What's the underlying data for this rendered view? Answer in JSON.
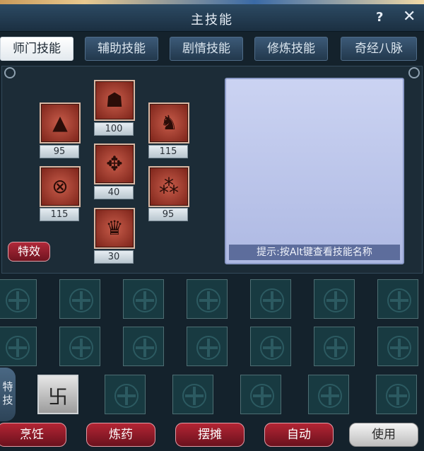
{
  "window": {
    "title": "主技能",
    "help_label": "?",
    "close_label": "✕"
  },
  "tabs": [
    {
      "label": "师门技能",
      "active": true
    },
    {
      "label": "辅助技能",
      "active": false
    },
    {
      "label": "剧情技能",
      "active": false
    },
    {
      "label": "修炼技能",
      "active": false
    },
    {
      "label": "奇经八脉",
      "active": false
    }
  ],
  "skills": [
    {
      "icon": "pagoda-icon",
      "glyph": "▲",
      "level": "95"
    },
    {
      "icon": "demon-mask-icon",
      "glyph": "☗",
      "level": "100"
    },
    {
      "icon": "dragon-head-icon",
      "glyph": "♞",
      "level": "115"
    },
    {
      "icon": "talisman-icon",
      "glyph": "✥",
      "level": "40"
    },
    {
      "icon": "round-seal-icon",
      "glyph": "⊗",
      "level": "115"
    },
    {
      "icon": "grid-seal-icon",
      "glyph": "⁂",
      "level": "95"
    },
    {
      "icon": "flame-crown-icon",
      "glyph": "♛",
      "level": "30"
    }
  ],
  "effect_button": "特效",
  "preview": {
    "hint": "提示:按Alt键查看技能名称"
  },
  "special": {
    "label": "特技",
    "icon": "special-glyph-icon",
    "glyph": "卐"
  },
  "buttons": [
    {
      "label": "烹饪",
      "style": "red"
    },
    {
      "label": "炼药",
      "style": "red"
    },
    {
      "label": "摆摊",
      "style": "red"
    },
    {
      "label": "自动",
      "style": "red"
    },
    {
      "label": "使用",
      "style": "grey"
    }
  ]
}
